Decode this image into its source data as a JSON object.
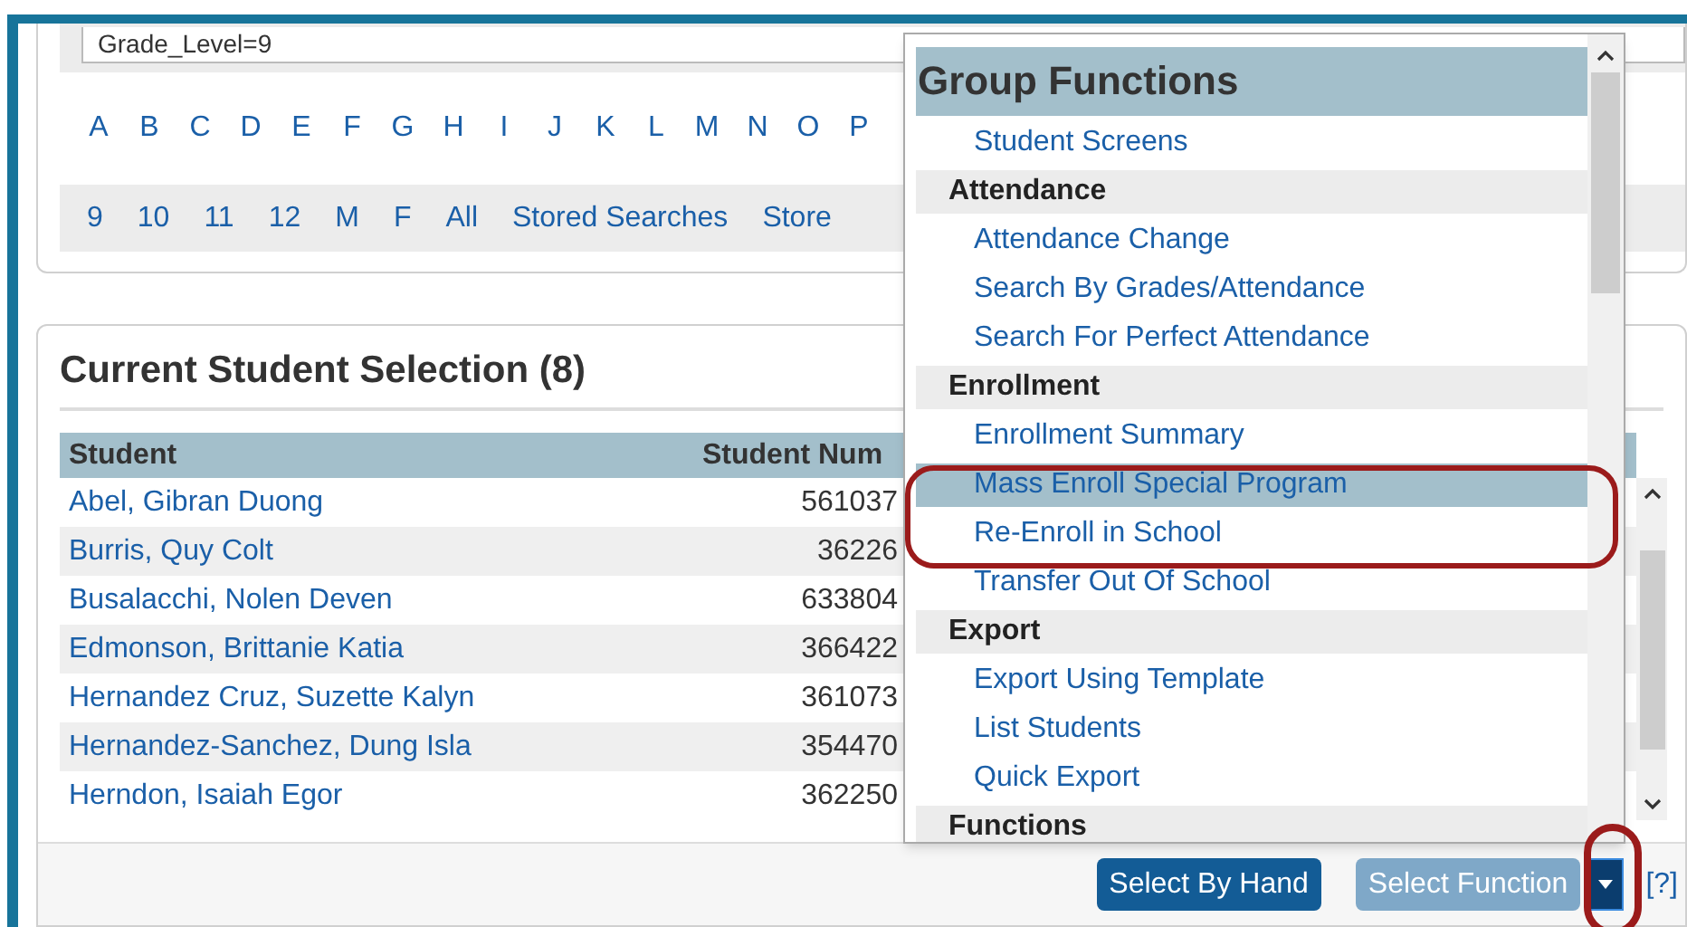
{
  "search_field": {
    "value": "Grade_Level=9"
  },
  "letters": [
    "A",
    "B",
    "C",
    "D",
    "E",
    "F",
    "G",
    "H",
    "I",
    "J",
    "K",
    "L",
    "M",
    "N",
    "O",
    "P"
  ],
  "quick_filters": [
    "9",
    "10",
    "11",
    "12",
    "M",
    "F",
    "All",
    "Stored Searches",
    "Store"
  ],
  "selection": {
    "title": "Current Student Selection (8)",
    "columns": [
      "Student",
      "Student Num"
    ],
    "rows": [
      {
        "student": "Abel, Gibran Duong",
        "number": "561037"
      },
      {
        "student": "Burris, Quy Colt",
        "number": "36226"
      },
      {
        "student": "Busalacchi, Nolen Deven",
        "number": "633804"
      },
      {
        "student": "Edmonson, Brittanie Katia",
        "number": "366422"
      },
      {
        "student": "Hernandez Cruz, Suzette Kalyn",
        "number": "361073"
      },
      {
        "student": "Hernandez-Sanchez, Dung Isla",
        "number": "354470"
      },
      {
        "student": "Herndon, Isaiah Egor",
        "number": "362250"
      }
    ]
  },
  "buttons": [
    {
      "label": "Select By Hand",
      "kind": "primary"
    },
    {
      "label": "Select Function",
      "kind": "secondary"
    }
  ],
  "help": "[?]",
  "group_functions": {
    "title": "Group Functions",
    "items": [
      {
        "kind": "link",
        "label": "Student Screens",
        "selected": false
      },
      {
        "kind": "heading",
        "label": "Attendance"
      },
      {
        "kind": "link",
        "label": "Attendance Change",
        "selected": false
      },
      {
        "kind": "link",
        "label": "Search By Grades/Attendance",
        "selected": false
      },
      {
        "kind": "link",
        "label": "Search For Perfect Attendance",
        "selected": false
      },
      {
        "kind": "heading",
        "label": "Enrollment"
      },
      {
        "kind": "link",
        "label": "Enrollment Summary",
        "selected": false
      },
      {
        "kind": "link",
        "label": "Mass Enroll Special Program",
        "selected": true
      },
      {
        "kind": "link",
        "label": "Re-Enroll in School",
        "selected": false
      },
      {
        "kind": "link",
        "label": "Transfer Out Of School",
        "selected": false
      },
      {
        "kind": "heading",
        "label": "Export"
      },
      {
        "kind": "link",
        "label": "Export Using Template",
        "selected": false
      },
      {
        "kind": "link",
        "label": "List Students",
        "selected": false
      },
      {
        "kind": "link",
        "label": "Quick Export",
        "selected": false
      },
      {
        "kind": "heading",
        "label": "Functions"
      }
    ]
  }
}
